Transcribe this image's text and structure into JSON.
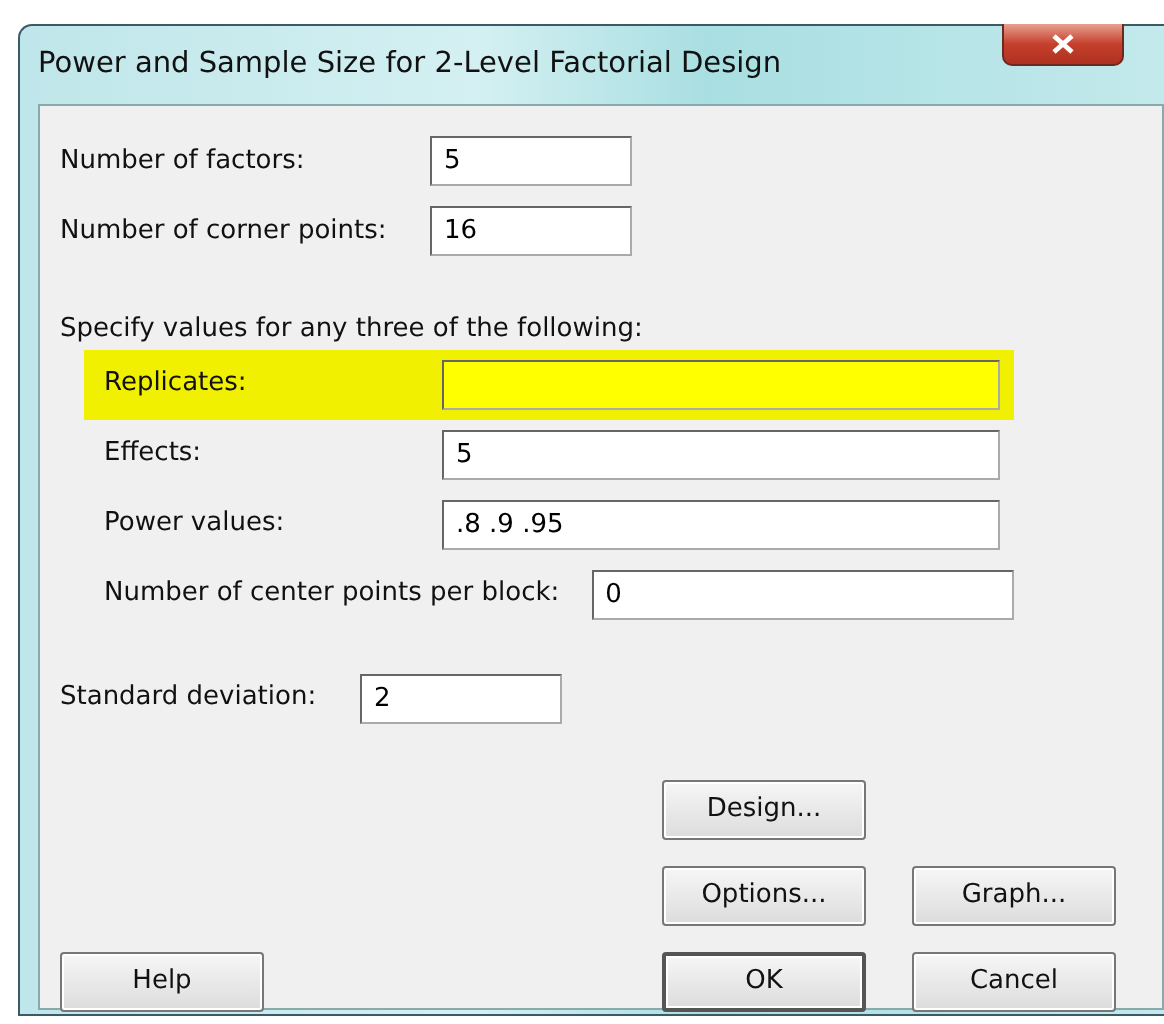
{
  "window": {
    "title": "Power and Sample Size for 2-Level Factorial Design"
  },
  "fields": [
    {
      "label": "Number of factors:",
      "value": "5"
    },
    {
      "label": "Number of corner points:",
      "value": "16"
    }
  ],
  "instruction": "Specify values for any three of the following:",
  "options": [
    {
      "label": "Replicates:",
      "highlighted": true,
      "kind": "normal"
    },
    {
      "label": "Effects:",
      "value": "5",
      "highlighted": false,
      "kind": "normal"
    },
    {
      "label": "Power values:",
      "value": ".8 .9 .95",
      "highlighted": false,
      "kind": "normal"
    },
    {
      "label": "Number of center points per block:",
      "value": "0",
      "highlighted": false,
      "kind": "wide"
    }
  ],
  "std_dev": {
    "label": "Standard deviation:",
    "value": "2"
  },
  "button_columns": [
    {
      "buttons": [
        {
          "label": "Help",
          "default": false
        }
      ]
    },
    {
      "buttons": [
        {
          "label": "Design...",
          "default": false
        },
        {
          "label": "Options...",
          "default": false
        },
        {
          "label": "OK",
          "default": true
        }
      ]
    },
    {
      "buttons": [
        {
          "label": "Graph...",
          "default": false
        },
        {
          "label": "Cancel",
          "default": false
        }
      ]
    }
  ]
}
